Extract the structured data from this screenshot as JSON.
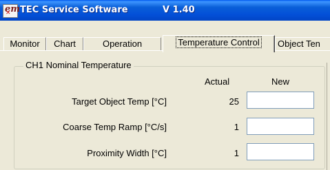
{
  "window": {
    "title": "TEC Service Software",
    "version": "V 1.40",
    "icon_text": "em",
    "icon_glyph": "✕"
  },
  "tabs": [
    {
      "label": "Monitor",
      "active": false
    },
    {
      "label": "Chart",
      "active": false
    },
    {
      "label": "Operation",
      "active": false
    },
    {
      "label": "Temperature Control",
      "active": true
    },
    {
      "label": "Object Ten",
      "active": false
    }
  ],
  "group": {
    "title": "CH1 Nominal Temperature",
    "columns": {
      "actual": "Actual",
      "new": "New"
    },
    "rows": [
      {
        "label": "Target Object Temp [°C]",
        "actual": "25",
        "new_value": ""
      },
      {
        "label": "Coarse Temp Ramp [°C/s]",
        "actual": "1",
        "new_value": ""
      },
      {
        "label": "Proximity Width [°C]",
        "actual": "1",
        "new_value": ""
      }
    ]
  },
  "colors": {
    "titlebar": "#0350d8",
    "face": "#ece9d8",
    "input_border": "#7f9db9"
  }
}
